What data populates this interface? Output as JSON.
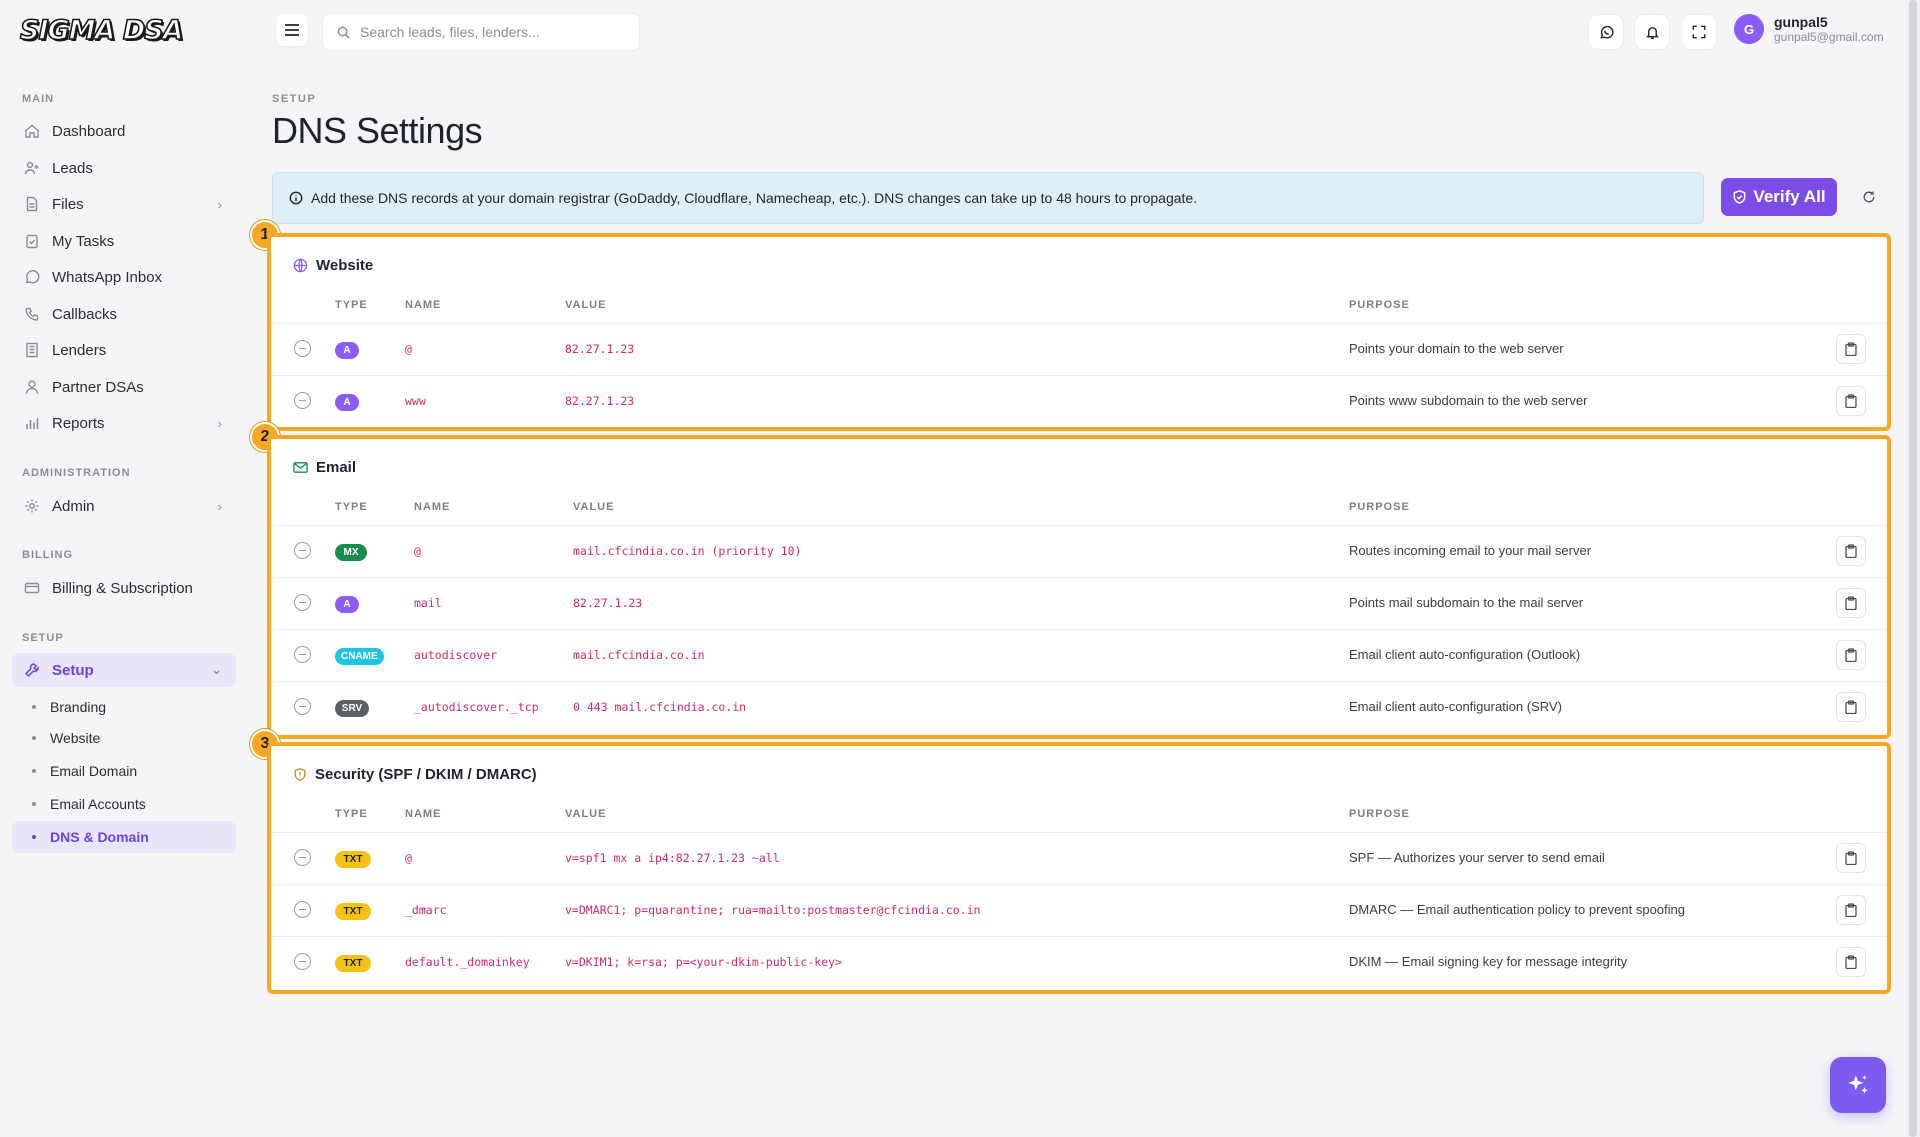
{
  "brand": {
    "logo_text": "SIGMA DSA"
  },
  "sidebar": {
    "sections": {
      "main": "MAIN",
      "administration": "ADMINISTRATION",
      "billing": "BILLING",
      "setup": "SETUP"
    },
    "items": {
      "dashboard": "Dashboard",
      "leads": "Leads",
      "files": "Files",
      "tasks": "My Tasks",
      "whatsapp": "WhatsApp Inbox",
      "callbacks": "Callbacks",
      "lenders": "Lenders",
      "partners": "Partner DSAs",
      "reports": "Reports",
      "admin": "Admin",
      "billing": "Billing & Subscription",
      "setup": "Setup"
    },
    "setup_sub": {
      "branding": "Branding",
      "website": "Website",
      "email_domain": "Email Domain",
      "email_accounts": "Email Accounts",
      "dns": "DNS & Domain"
    }
  },
  "topbar": {
    "search_placeholder": "Search leads, files, lenders...",
    "user": {
      "initial": "G",
      "name": "gunpal5",
      "email": "gunpal5@gmail.com"
    }
  },
  "page": {
    "breadcrumb": "SETUP",
    "title": "DNS Settings",
    "info": "Add these DNS records at your domain registrar (GoDaddy, Cloudflare, Namecheap, etc.). DNS changes can take up to 48 hours to propagate.",
    "verify_label": "Verify All"
  },
  "table_headers": {
    "type": "TYPE",
    "name": "NAME",
    "value": "VALUE",
    "purpose": "PURPOSE"
  },
  "groups": {
    "website": {
      "number": "1",
      "title": "Website",
      "rows": [
        {
          "type": "A",
          "name": "@",
          "value": "82.27.1.23",
          "purpose": "Points your domain to the web server"
        },
        {
          "type": "A",
          "name": "www",
          "value": "82.27.1.23",
          "purpose": "Points www subdomain to the web server"
        }
      ]
    },
    "email": {
      "number": "2",
      "title": "Email",
      "rows": [
        {
          "type": "MX",
          "name": "@",
          "value": "mail.cfcindia.co.in (priority 10)",
          "purpose": "Routes incoming email to your mail server"
        },
        {
          "type": "A",
          "name": "mail",
          "value": "82.27.1.23",
          "purpose": "Points mail subdomain to the mail server"
        },
        {
          "type": "CNAME",
          "name": "autodiscover",
          "value": "mail.cfcindia.co.in",
          "purpose": "Email client auto-configuration (Outlook)"
        },
        {
          "type": "SRV",
          "name": "_autodiscover._tcp",
          "value": "0 443 mail.cfcindia.co.in",
          "purpose": "Email client auto-configuration (SRV)"
        }
      ]
    },
    "security": {
      "number": "3",
      "title": "Security (SPF / DKIM / DMARC)",
      "rows": [
        {
          "type": "TXT",
          "name": "@",
          "value": "v=spf1 mx a ip4:82.27.1.23 ~all",
          "purpose": "SPF — Authorizes your server to send email"
        },
        {
          "type": "TXT",
          "name": "_dmarc",
          "value": "v=DMARC1; p=quarantine; rua=mailto:postmaster@cfcindia.co.in",
          "purpose": "DMARC — Email authentication policy to prevent spoofing"
        },
        {
          "type": "TXT",
          "name": "default._domainkey",
          "value": "v=DKIM1; k=rsa; p=<your-dkim-public-key>",
          "purpose": "DKIM — Email signing key for message integrity"
        }
      ]
    }
  },
  "colors": {
    "accent": "#7c4de6",
    "highlight": "#f6a724",
    "value_text": "#d42a6b"
  }
}
